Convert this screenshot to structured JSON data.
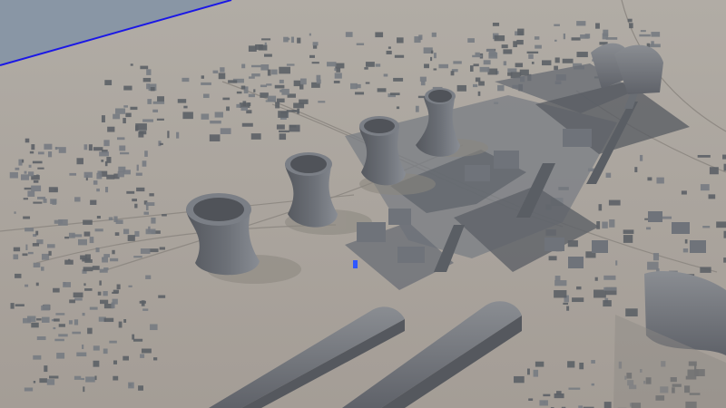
{
  "scene": {
    "description_visible_text": "",
    "colors": {
      "sky": "#8a98a8",
      "ground": "#aaa49d",
      "boundary_line": "#1a17e6",
      "structure_dark": "#54575d",
      "structure_mid": "#6c7077",
      "structure_light": "#878b92",
      "shadow": "#62666c",
      "selection_marker": "#2f57ff"
    },
    "objects": {
      "cooling_tower_count": 4,
      "storage_shed_count": 4,
      "chimney_count": 3
    }
  }
}
